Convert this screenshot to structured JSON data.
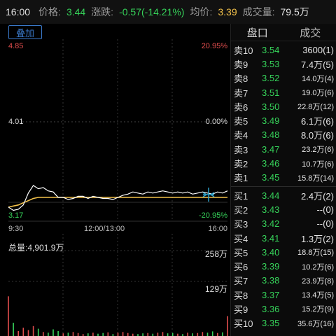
{
  "topbar": {
    "time": "16:00",
    "price_label": "价格:",
    "price_value": "3.44",
    "change_label": "涨跌:",
    "change_value": "-0.57(-14.21%)",
    "avg_label": "均价:",
    "avg_value": "3.39",
    "volume_label": "成交量:",
    "volume_value": "79.5万"
  },
  "chart": {
    "overlay_button": "叠加",
    "y_top_left": "4.85",
    "y_mid_left": "4.01",
    "y_bottom_left": "3.17",
    "y_top_right": "20.95%",
    "y_mid_right": "0.00%",
    "y_bottom_right": "-20.95%",
    "time_start": "9:30",
    "time_mid": "12:00/13:00",
    "time_end": "16:00",
    "total_volume_label": "总量:4,901.9万",
    "vol_top_label": "258万",
    "vol_mid_label": "129万"
  },
  "chart_data": {
    "type": "line",
    "price_series": [
      3.3,
      3.27,
      3.28,
      3.32,
      3.43,
      3.5,
      3.47,
      3.48,
      3.45,
      3.44,
      3.39,
      3.39,
      3.37,
      3.38,
      3.4,
      3.4,
      3.38,
      3.4,
      3.39,
      3.38,
      3.38,
      3.37,
      3.39,
      3.41,
      3.42,
      3.44,
      3.43,
      3.42,
      3.44,
      3.43,
      3.44,
      3.45,
      3.44,
      3.43,
      3.44,
      3.43,
      3.44,
      3.42,
      3.43,
      3.44,
      3.43,
      3.42,
      3.44,
      3.43,
      3.45
    ],
    "avg_series": [
      3.3,
      3.31,
      3.32,
      3.34,
      3.36,
      3.38,
      3.39,
      3.39,
      3.39,
      3.39,
      3.39,
      3.39,
      3.39,
      3.39,
      3.39,
      3.39,
      3.39,
      3.39,
      3.39,
      3.39,
      3.39,
      3.39,
      3.39,
      3.39,
      3.39,
      3.39,
      3.39,
      3.39,
      3.39,
      3.39,
      3.39,
      3.39,
      3.39,
      3.39,
      3.39,
      3.39,
      3.39,
      3.39,
      3.39,
      3.39,
      3.39,
      3.39,
      3.39,
      3.39,
      3.39
    ],
    "volume_series": [
      120,
      40,
      15,
      25,
      18,
      30,
      22,
      12,
      10,
      20,
      15,
      8,
      10,
      12,
      9,
      6,
      8,
      10,
      7,
      9,
      11,
      6,
      10,
      12,
      9,
      7,
      6,
      8,
      9,
      7,
      10,
      12,
      8,
      9,
      7,
      6,
      10,
      8,
      9,
      12,
      10,
      14,
      9,
      11,
      60
    ],
    "ylim": [
      3.17,
      4.85
    ],
    "vol_max": 258
  },
  "orderbook": {
    "tabs": [
      "盘口",
      "成交"
    ],
    "asks": [
      {
        "label": "卖10",
        "price": "3.54",
        "vol": "3600(1)"
      },
      {
        "label": "卖9",
        "price": "3.53",
        "vol": "7.4万(5)"
      },
      {
        "label": "卖8",
        "price": "3.52",
        "vol": "14.0万(4)"
      },
      {
        "label": "卖7",
        "price": "3.51",
        "vol": "19.0万(6)"
      },
      {
        "label": "卖6",
        "price": "3.50",
        "vol": "22.8万(12)"
      },
      {
        "label": "卖5",
        "price": "3.49",
        "vol": "6.1万(6)"
      },
      {
        "label": "卖4",
        "price": "3.48",
        "vol": "8.0万(6)"
      },
      {
        "label": "卖3",
        "price": "3.47",
        "vol": "23.2万(6)"
      },
      {
        "label": "卖2",
        "price": "3.46",
        "vol": "10.7万(6)"
      },
      {
        "label": "卖1",
        "price": "3.45",
        "vol": "15.8万(14)"
      }
    ],
    "bids": [
      {
        "label": "买1",
        "price": "3.44",
        "vol": "2.4万(2)"
      },
      {
        "label": "买2",
        "price": "3.43",
        "vol": "--(0)"
      },
      {
        "label": "买3",
        "price": "3.42",
        "vol": "--(0)"
      },
      {
        "label": "买4",
        "price": "3.41",
        "vol": "1.3万(2)"
      },
      {
        "label": "买5",
        "price": "3.40",
        "vol": "18.8万(15)"
      },
      {
        "label": "买6",
        "price": "3.39",
        "vol": "10.2万(6)"
      },
      {
        "label": "买7",
        "price": "3.38",
        "vol": "23.9万(8)"
      },
      {
        "label": "买8",
        "price": "3.37",
        "vol": "13.4万(5)"
      },
      {
        "label": "买9",
        "price": "3.36",
        "vol": "15.2万(9)"
      },
      {
        "label": "买10",
        "price": "3.35",
        "vol": "35.6万(16)"
      }
    ]
  },
  "colors": {
    "green": "#36d35a",
    "red": "#e24d4d",
    "yellow": "#f2c14a",
    "blue": "#3a78c8"
  }
}
